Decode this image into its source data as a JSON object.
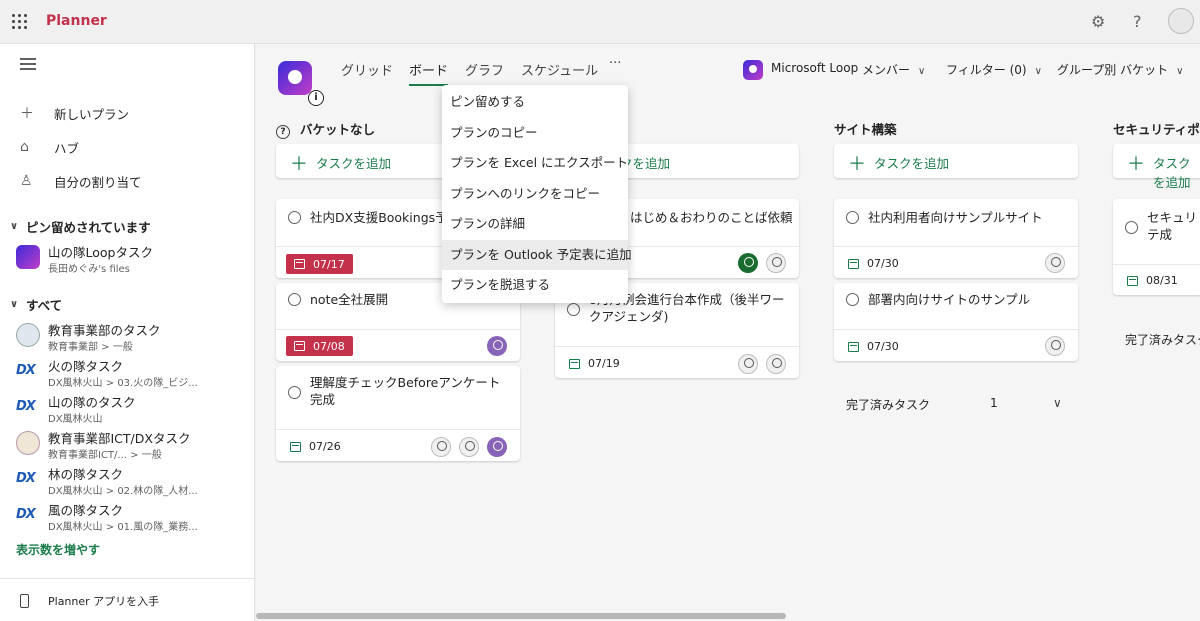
{
  "app": {
    "title": "Planner"
  },
  "topbar": {
    "settings_icon": "gear-icon",
    "help_label": "?"
  },
  "sidebar": {
    "nav": [
      {
        "label": "新しいプラン",
        "icon": "plus-icon"
      },
      {
        "label": "ハブ",
        "icon": "home-icon"
      },
      {
        "label": "自分の割り当て",
        "icon": "person-icon"
      }
    ],
    "pinned_header": "ピン留めされています",
    "pinned": [
      {
        "name": "山の隊Loopタスク",
        "sub": "長田めぐみ's files"
      }
    ],
    "all_header": "すべて",
    "plans": [
      {
        "name": "教育事業部のタスク",
        "sub1": "教育事業部",
        "sub2": "一般",
        "icon": "avatar"
      },
      {
        "name": "火の隊タスク",
        "sub1": "DX風林火山",
        "sub2": "03.火の隊_ビジ...",
        "icon": "DX"
      },
      {
        "name": "山の隊のタスク",
        "sub1": "DX風林火山",
        "sub2": "",
        "icon": "DX"
      },
      {
        "name": "教育事業部ICT/DXタスク",
        "sub1": "教育事業部ICT/...",
        "sub2": "一般",
        "icon": "avatar"
      },
      {
        "name": "林の隊タスク",
        "sub1": "DX風林火山",
        "sub2": "02.林の隊_人材...",
        "icon": "DX"
      },
      {
        "name": "風の隊タスク",
        "sub1": "DX風林火山",
        "sub2": "01.風の隊_業務...",
        "icon": "DX"
      }
    ],
    "show_more": "表示数を増やす",
    "footer": "Planner アプリを入手"
  },
  "tabs": [
    "グリッド",
    "ボード",
    "グラフ",
    "スケジュール",
    "···"
  ],
  "right_controls": {
    "loop": "Microsoft Loop",
    "members": "メンバー",
    "filter": "フィルター (0)",
    "group": "グループ別 バケット"
  },
  "add_task_label": "タスクを追加",
  "columns": [
    {
      "title": "バケットなし"
    },
    {
      "title": ""
    },
    {
      "title": "サイト構築"
    },
    {
      "title": "セキュリティポリ"
    }
  ],
  "cards": {
    "c1": {
      "title": "社内DX支援Bookings予約",
      "date": "07/17"
    },
    "c2": {
      "title": "note全社展開",
      "date": "07/08"
    },
    "c3": {
      "title": "理解度チェックBeforeアンケート完成",
      "date": "07/26"
    },
    "c4": {
      "title": "はじめ＆おわりのことば依頼"
    },
    "c5": {
      "title": "8月月例会進行台本作成（後半ワークアジェンダ)",
      "date": "07/19"
    },
    "c6": {
      "title": "社内利用者向けサンプルサイト",
      "date": "07/30"
    },
    "c7": {
      "title": "部署内向けサイトのサンプル",
      "date": "07/30"
    },
    "c8": {
      "title": "セキュリテ成",
      "date": "08/31"
    }
  },
  "completed": {
    "label": "完了済みタスク",
    "count": "1",
    "partial_label": "完了済みタスク"
  },
  "menu": [
    "ピン留めする",
    "プランのコピー",
    "プランを Excel にエクスポート",
    "プランへのリンクをコピー",
    "プランの詳細",
    "プランを Outlook 予定表に追加",
    "プランを脱退する"
  ],
  "colors": {
    "accent": "#1a7c4a",
    "brand": "#c4314b",
    "overdue": "#c4314b"
  }
}
